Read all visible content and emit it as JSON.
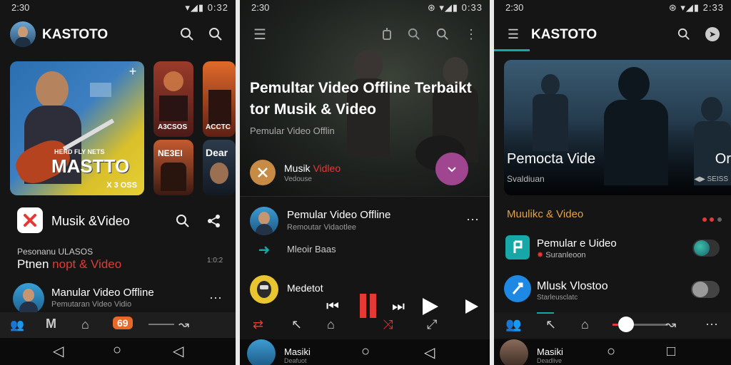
{
  "p1": {
    "status_time": "2:30",
    "status_right": "▾◢▮ 0:32",
    "app_title": "KASTOTO",
    "card_main_title": "MASTTO",
    "card_main_subtitle": "HERD FLY NETS",
    "card_main_badge": "X 3 OSS",
    "card_side1_top": "A3CSOS",
    "card_side1_bottom": "NE3EI",
    "card_side2_top": "ACCTC",
    "card_side2_bottom": "Dear",
    "section_title": "Musik &Video",
    "promo_line1": "Pesonanu ULASOS",
    "promo_line2_white": "Ptnen ",
    "promo_line2_red": "nopt & Video",
    "promo_count": "1:0:2",
    "row_title": "Manular Video Offline",
    "row_sub": "Pemutaran Video Vidio",
    "bottom_badge": "69"
  },
  "p2": {
    "status_time": "2:30",
    "status_right": "⊛ ▾◢▮ 0:33",
    "hero_line1": "Pemultar Video Offline Terbaikt",
    "hero_line2": "tor Musik & Video",
    "hero_sub": "Pemular Video Offlin",
    "chip_label_white": "Musik ",
    "chip_label_red": "Vidleo",
    "chip_sub": "Vedouse",
    "row1_title": "Pemular Video Offline",
    "row1_sub": "Remoutar Vidaotlee",
    "row2_title": "Mleoir Baas",
    "row3_title": "Medetot",
    "mini_title": "Masiki",
    "mini_sub": "Deafuot"
  },
  "p3": {
    "status_time": "2:30",
    "status_right": "⊛ ▾◢▮ 2:33",
    "app_title": "KASTOTO",
    "hero_title": "Pemocta Vide",
    "hero_title_right": "Or",
    "hero_sub": "Svaldiuan",
    "hero_right_sub": "◀▶ SEISS",
    "section_title": "Muulikc & Video",
    "row1_title": "Pemular e Uideo",
    "row1_sub": "Suranleoon",
    "row2_title": "Mlusk Vlostoo",
    "row2_sub": "Starleusclatc",
    "mini_title": "Masiki",
    "mini_sub": "Deadlive"
  },
  "colors": {
    "red": "#e53935",
    "teal": "#18a7a7",
    "accent_purple": "#a0458f"
  }
}
